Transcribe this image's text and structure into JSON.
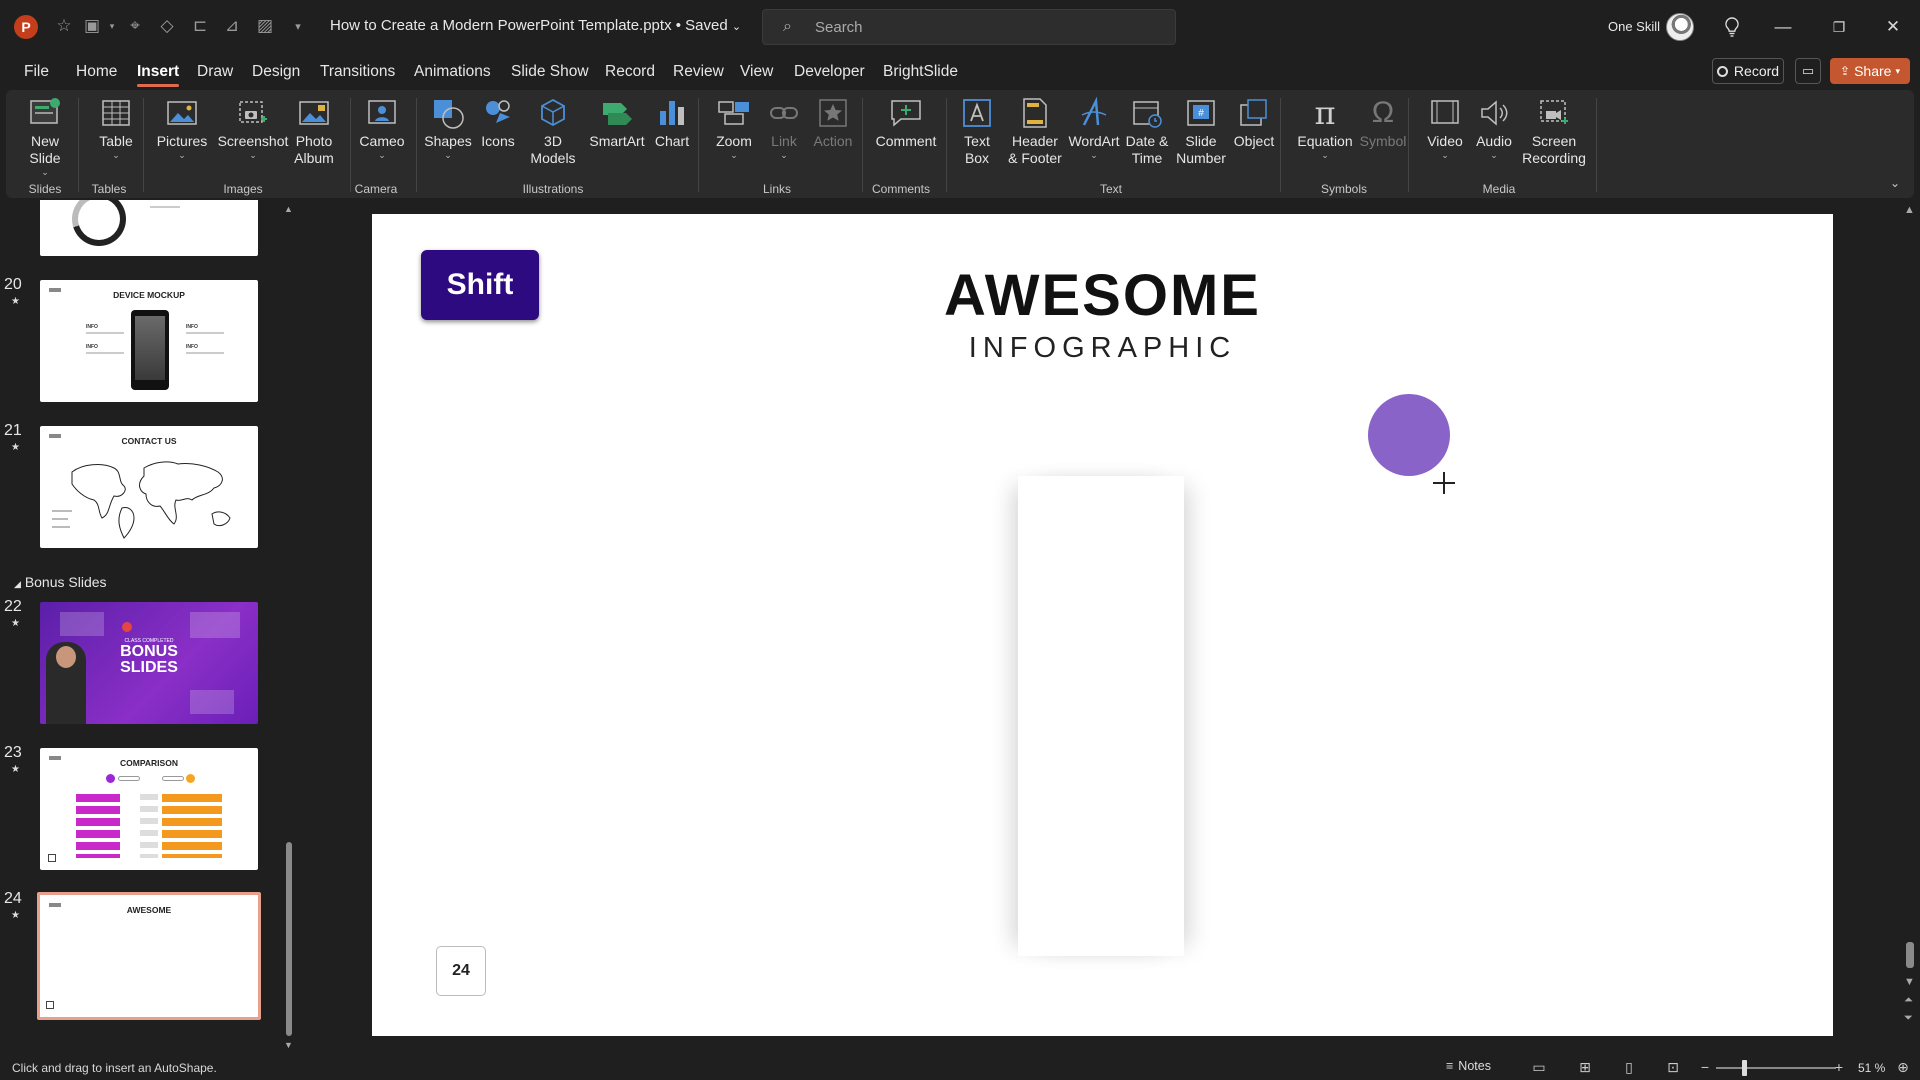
{
  "titlebar": {
    "doc_title": "How to Create a Modern PowerPoint Template.pptx • Saved",
    "search_placeholder": "Search",
    "user_name": "One Skill"
  },
  "menu": {
    "tabs": [
      "File",
      "Home",
      "Insert",
      "Draw",
      "Design",
      "Transitions",
      "Animations",
      "Slide Show",
      "Record",
      "Review",
      "View",
      "Developer",
      "BrightSlide"
    ],
    "active_tab": "Insert",
    "record_label": "Record",
    "share_label": "Share"
  },
  "ribbon": {
    "buttons": {
      "new_slide": "New\nSlide",
      "table": "Table",
      "pictures": "Pictures",
      "screenshot": "Screenshot",
      "photo_album": "Photo\nAlbum",
      "cameo": "Cameo",
      "shapes": "Shapes",
      "icons": "Icons",
      "models_3d": "3D\nModels",
      "smartart": "SmartArt",
      "chart": "Chart",
      "zoom": "Zoom",
      "link": "Link",
      "action": "Action",
      "comment": "Comment",
      "text_box": "Text\nBox",
      "header_footer": "Header\n& Footer",
      "wordart": "WordArt",
      "date_time": "Date &\nTime",
      "slide_number": "Slide\nNumber",
      "object": "Object",
      "equation": "Equation",
      "symbol": "Symbol",
      "video": "Video",
      "audio": "Audio",
      "screen_recording": "Screen\nRecording"
    },
    "groups": {
      "slides": "Slides",
      "tables": "Tables",
      "images": "Images",
      "camera": "Camera",
      "illustrations": "Illustrations",
      "links": "Links",
      "comments": "Comments",
      "text": "Text",
      "symbols": "Symbols",
      "media": "Media"
    }
  },
  "thumbnails": {
    "section_name": "Bonus Slides",
    "slides": [
      {
        "num": "20",
        "title": "DEVICE MOCKUP",
        "info": "INFO"
      },
      {
        "num": "21",
        "title": "CONTACT US"
      },
      {
        "num": "22",
        "small": "CLASS COMPLETED",
        "title": "BONUS",
        "title2": "SLIDES"
      },
      {
        "num": "23",
        "title": "COMPARISON"
      },
      {
        "num": "24",
        "title": "AWESOME"
      }
    ]
  },
  "slide": {
    "badge": "Shift",
    "title": "AWESOME",
    "subtitle": "INFOGRAPHIC",
    "page_number": "24",
    "circle_color": "#8a63c9"
  },
  "status": {
    "message": "Click and drag to insert an AutoShape.",
    "notes_label": "Notes",
    "zoom": "51 %"
  },
  "colors": {
    "accent": "#e06b4a",
    "share": "#c4572f",
    "badge": "#2e0a80"
  }
}
